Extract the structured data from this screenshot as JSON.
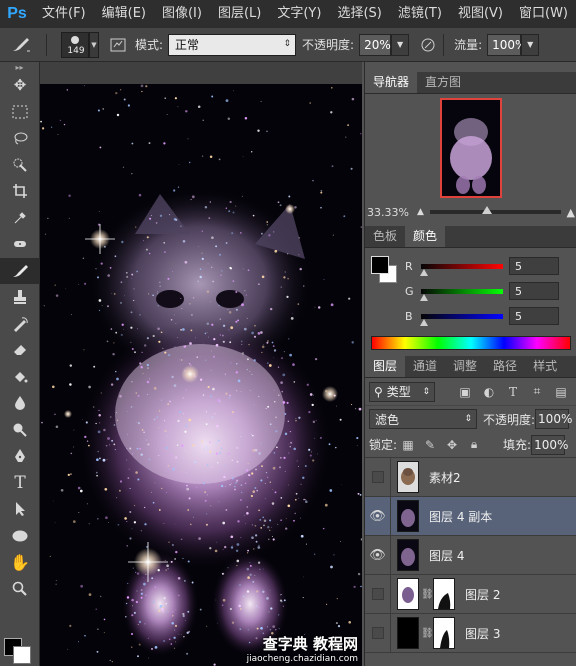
{
  "app": {
    "logo": "Ps"
  },
  "menu": [
    "文件(F)",
    "编辑(E)",
    "图像(I)",
    "图层(L)",
    "文字(Y)",
    "选择(S)",
    "滤镜(T)",
    "视图(V)",
    "窗口(W)"
  ],
  "options": {
    "brush_size": "149",
    "mode_label": "模式:",
    "mode_value": "正常",
    "opacity_label": "不透明度:",
    "opacity_value": "20%",
    "flow_label": "流量:",
    "flow_value": "100%"
  },
  "navigator": {
    "tabs": [
      "导航器",
      "直方图"
    ],
    "zoom": "33.33%"
  },
  "color": {
    "tabs": [
      "色板",
      "颜色"
    ],
    "r_label": "R",
    "r_value": "5",
    "g_label": "G",
    "g_value": "5",
    "b_label": "B",
    "b_value": "5",
    "foreground": "#050505",
    "background": "#ffffff"
  },
  "layers": {
    "tabs": [
      "图层",
      "通道",
      "调整",
      "路径",
      "样式"
    ],
    "filter_label": "类型",
    "blend_mode": "滤色",
    "opacity_label": "不透明度:",
    "opacity_value": "100%",
    "lock_label": "锁定:",
    "fill_label": "填充:",
    "fill_value": "100%",
    "items": [
      {
        "name": "素材2",
        "visible": false,
        "selected": false
      },
      {
        "name": "图层 4 副本",
        "visible": true,
        "selected": true
      },
      {
        "name": "图层 4",
        "visible": true,
        "selected": false
      },
      {
        "name": "图层 2",
        "visible": false,
        "selected": false
      },
      {
        "name": "图层 3",
        "visible": false,
        "selected": false
      }
    ]
  },
  "watermark": {
    "main": "查字典 教程网",
    "sub": "jiaocheng.chazidian.com"
  },
  "tools": [
    "move-icon",
    "marquee-icon",
    "lasso-icon",
    "quick-select-icon",
    "crop-icon",
    "eyedropper-icon",
    "healing-icon",
    "brush-icon",
    "stamp-icon",
    "history-brush-icon",
    "eraser-icon",
    "paint-bucket-icon",
    "blur-icon",
    "dodge-icon",
    "pen-icon",
    "type-icon",
    "path-select-icon",
    "ellipse-icon",
    "hand-icon",
    "zoom-icon"
  ]
}
